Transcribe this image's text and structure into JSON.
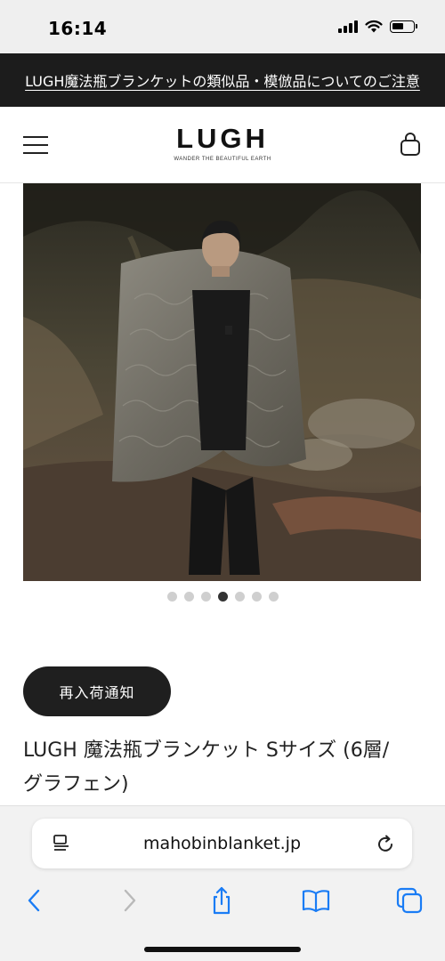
{
  "status_bar": {
    "time": "16:14"
  },
  "announcement": {
    "text": "LUGH魔法瓶ブランケットの類似品・模倣品についてのご注意"
  },
  "header": {
    "logo_text": "LUGH",
    "logo_tagline": "WANDER THE BEAUTIFUL EARTH"
  },
  "carousel": {
    "total": 7,
    "active_index": 4
  },
  "product": {
    "restock_button": "再入荷通知",
    "title_line1": "LUGH 魔法瓶ブランケット Sサイズ (6層/",
    "title_line2": "グラフェン)"
  },
  "browser": {
    "url": "mahobinblanket.jp"
  },
  "colors": {
    "announce_bg": "#1c1c1c",
    "button_bg": "#1f1f1f",
    "accent_blue": "#1a7cf5"
  }
}
